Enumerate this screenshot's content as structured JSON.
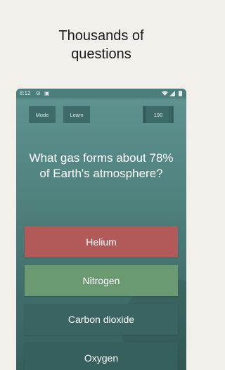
{
  "promo": {
    "line1": "Thousands of",
    "line2": "questions"
  },
  "status_bar": {
    "time": "8:12",
    "icons": [
      "do-not-disturb-icon",
      "notification-icon",
      "wifi-icon",
      "signal-icon",
      "battery-icon"
    ]
  },
  "toolbar": {
    "mode_label": "Mode",
    "learn_label": "Learn",
    "counter": "190"
  },
  "quiz": {
    "question": "What gas forms about 78% of Earth's atmosphere?",
    "answers": [
      {
        "label": "Helium",
        "state": "wrong",
        "color": "#b25a5a"
      },
      {
        "label": "Nitrogen",
        "state": "correct",
        "color": "#6b9a72"
      },
      {
        "label": "Carbon dioxide",
        "state": "neutral",
        "color": "#3a6461"
      },
      {
        "label": "Oxygen",
        "state": "neutral",
        "color": "#36605d"
      }
    ]
  },
  "colors": {
    "background": "#f3f0ec",
    "app_bg": "#4f817d"
  }
}
